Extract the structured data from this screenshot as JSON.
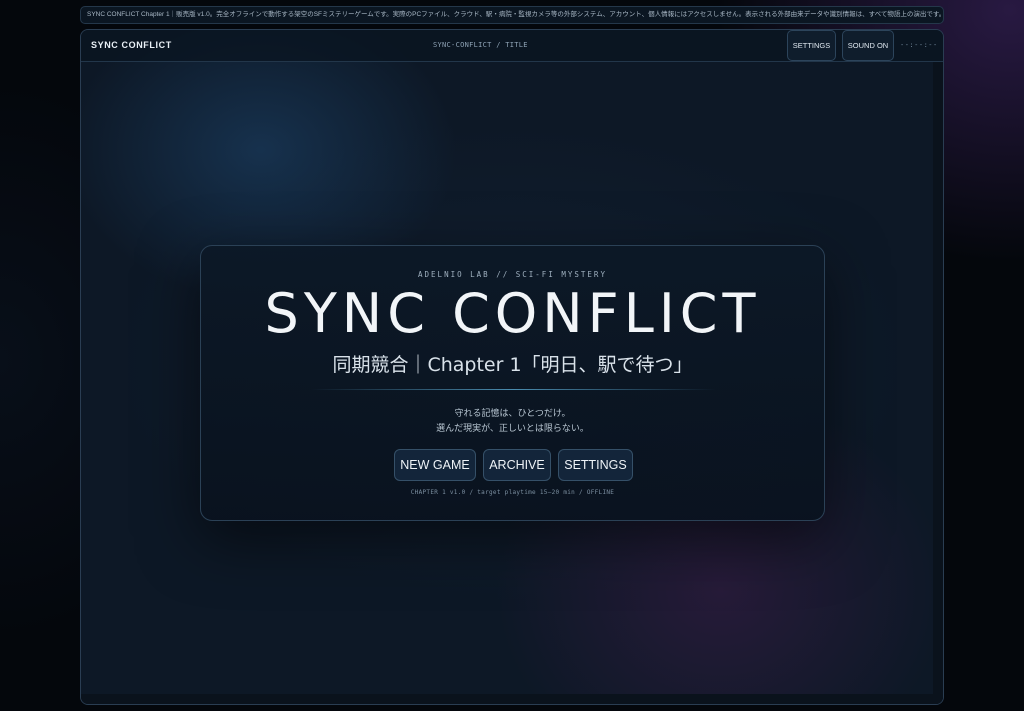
{
  "notice": "SYNC CONFLICT Chapter 1｜販売版 v1.0。完全オフラインで動作する架空のSFミステリーゲームです。実際のPCファイル、クラウド、駅・病院・監視カメラ等の外部システム、アカウント、個人情報にはアクセスしません。表示される外部由来データや識別情報は、すべて物語上の演出です。",
  "topbar": {
    "brand": "SYNC CONFLICT",
    "breadcrumb": "SYNC-CONFLICT / TITLE",
    "settings_label": "SETTINGS",
    "sound_label": "SOUND ON",
    "clock": "--:--:--"
  },
  "title_card": {
    "kicker": "ADELNIO LAB // SCI-FI MYSTERY",
    "title": "SYNC CONFLICT",
    "subtitle": "同期競合｜Chapter 1「明日、駅で待つ」",
    "tagline_1": "守れる記憶は、ひとつだけ。",
    "tagline_2": "選んだ現実が、正しいとは限らない。",
    "buttons": {
      "new_game": "NEW GAME",
      "archive": "ARCHIVE",
      "settings": "SETTINGS"
    },
    "footnote": "CHAPTER 1 v1.0 / target playtime 15–20 min / OFFLINE"
  }
}
